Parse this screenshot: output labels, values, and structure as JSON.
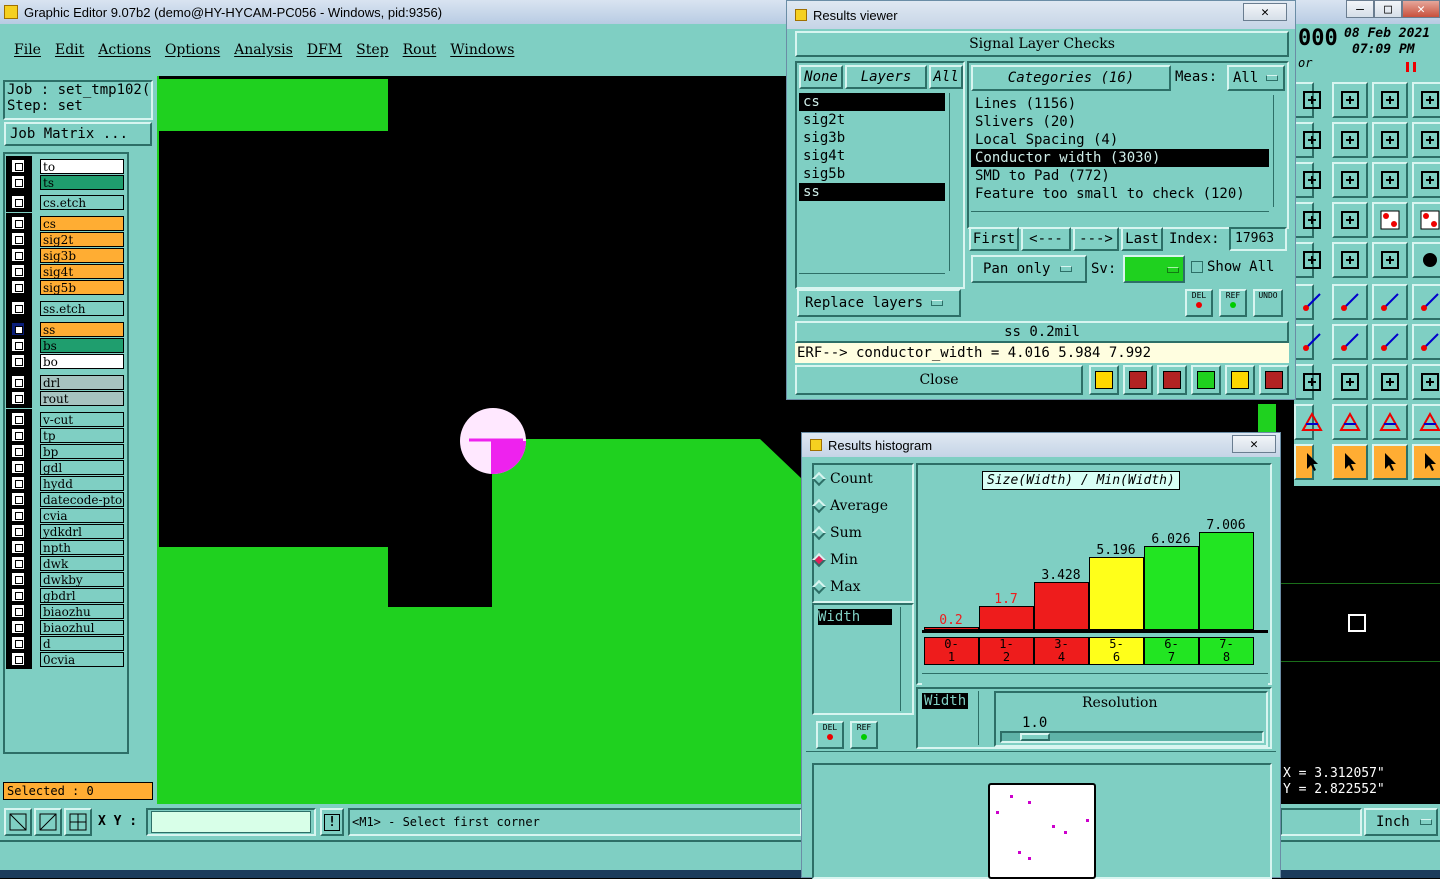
{
  "app": {
    "title": "Graphic Editor 9.07b2 (demo@HY-HYCAM-PC056 - Windows, pid:9356)",
    "date": "08 Feb 2021",
    "time": "07:09 PM",
    "counter": "000",
    "counter_sub": "or"
  },
  "menu": [
    "File",
    "Edit",
    "Actions",
    "Options",
    "Analysis",
    "DFM",
    "Step",
    "Rout",
    "Windows"
  ],
  "left": {
    "job_label": "Job  :  set_tmp102(",
    "step_label": "Step:  set",
    "job_matrix_btn": "Job Matrix ...",
    "selected": "Selected : 0",
    "layers": [
      {
        "name": "to",
        "color": "#ffffff"
      },
      {
        "name": "ts",
        "color": "#1f9e6e"
      },
      {
        "name": "cs.etch",
        "color": "#7fcfc3"
      },
      {
        "name": "cs",
        "color": "#ffad33"
      },
      {
        "name": "sig2t",
        "color": "#ffad33"
      },
      {
        "name": "sig3b",
        "color": "#ffad33"
      },
      {
        "name": "sig4t",
        "color": "#ffad33"
      },
      {
        "name": "sig5b",
        "color": "#ffad33"
      },
      {
        "name": "ss.etch",
        "color": "#7fcfc3"
      },
      {
        "name": "ss",
        "color": "#ffad33"
      },
      {
        "name": "bs",
        "color": "#1f9e6e"
      },
      {
        "name": "bo",
        "color": "#ffffff"
      },
      {
        "name": "drl",
        "color": "#a7c3c0"
      },
      {
        "name": "rout",
        "color": "#a7c3c0"
      },
      {
        "name": "v-cut",
        "color": "#7fcfc3"
      },
      {
        "name": "tp",
        "color": "#7fcfc3"
      },
      {
        "name": "bp",
        "color": "#7fcfc3"
      },
      {
        "name": "gdl",
        "color": "#7fcfc3"
      },
      {
        "name": "hydd",
        "color": "#7fcfc3"
      },
      {
        "name": "datecode-pto",
        "color": "#7fcfc3"
      },
      {
        "name": "cvia",
        "color": "#7fcfc3"
      },
      {
        "name": "ydkdrl",
        "color": "#7fcfc3"
      },
      {
        "name": "npth",
        "color": "#7fcfc3"
      },
      {
        "name": "dwk",
        "color": "#7fcfc3"
      },
      {
        "name": "dwkby",
        "color": "#7fcfc3"
      },
      {
        "name": "gbdrl",
        "color": "#7fcfc3"
      },
      {
        "name": "biaozhu",
        "color": "#7fcfc3"
      },
      {
        "name": "biaozhul",
        "color": "#7fcfc3"
      },
      {
        "name": "d",
        "color": "#7fcfc3"
      },
      {
        "name": "0cvia",
        "color": "#7fcfc3"
      }
    ]
  },
  "status": {
    "xy_label": "X Y :",
    "xy_value": "",
    "prompt": "<M1> - Select first corner",
    "coord_x": "X = 3.312057\"",
    "coord_y": "Y = 2.822552\"",
    "units": "Inch"
  },
  "results_viewer": {
    "title": "Results viewer",
    "close_x": "✕",
    "header": "Signal Layer Checks",
    "none_btn": "None",
    "layers_btn": "Layers",
    "all_btn": "All",
    "categories_btn": "Categories (16)",
    "meas_label": "Meas:",
    "meas_value": "All",
    "layer_list": [
      "cs",
      "sig2t",
      "sig3b",
      "sig4t",
      "sig5b",
      "ss"
    ],
    "category_list": [
      "Lines (1156)",
      "Slivers (20)",
      "Local Spacing (4)",
      "Conductor width (3030)",
      "SMD to Pad (772)",
      "Feature too small to check (120)"
    ],
    "first_btn": "First",
    "prev_btn": "<---",
    "next_btn": "--->",
    "last_btn": "Last",
    "index_label": "Index:",
    "index_value": "17963",
    "pan_value": "Pan only",
    "sv_label": "Sv:",
    "show_all": "Show All",
    "replace_btn": "Replace layers",
    "del_icon": "DEL",
    "ref_icon": "REF",
    "undo_icon": "UNDO",
    "layer_info": "ss 0.2mil",
    "erf_line": "ERF--> conductor_width = 4.016 5.984 7.992",
    "close_btn": "Close"
  },
  "histogram": {
    "title": "Results histogram",
    "close_x": "✕",
    "modes": [
      "Count",
      "Average",
      "Sum",
      "Min",
      "Max"
    ],
    "selected_mode": "Min",
    "field_list": [
      "Width"
    ],
    "chart_title": "Size(Width) / Min(Width)",
    "del_icon": "DEL",
    "ref_icon": "REF",
    "width_tag": "Width",
    "resolution_label": "Resolution",
    "resolution_value": "1.0",
    "colors": {
      "red": "#ee1c1c",
      "yellow": "#ffff1a",
      "green": "#22e522"
    }
  },
  "chart_data": {
    "type": "bar",
    "title": "Size(Width) / Min(Width)",
    "categories": [
      "0-1",
      "1-2",
      "3-4",
      "5-6",
      "6-7",
      "7-8"
    ],
    "values": [
      0.2,
      1.7,
      3.428,
      5.196,
      6.026,
      7.006
    ],
    "value_labels": [
      "0.2",
      "1.7",
      "3.428",
      "5.196",
      "6.026",
      "7.006"
    ],
    "bin_top": [
      "0-",
      "1-",
      "3-",
      "5-",
      "6-",
      "7-"
    ],
    "bin_bottom": [
      "1",
      "2",
      "4",
      "6",
      "7",
      "8"
    ],
    "bar_colors": [
      "#ee1c1c",
      "#ee1c1c",
      "#ee1c1c",
      "#ffff1a",
      "#22e522",
      "#22e522"
    ],
    "label_colors": [
      "#ee1c1c",
      "#ee1c1c",
      "#000000",
      "#000000",
      "#000000",
      "#000000"
    ],
    "ylim": [
      0,
      8
    ]
  }
}
